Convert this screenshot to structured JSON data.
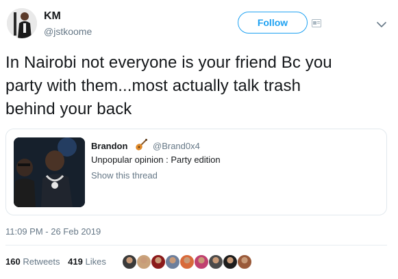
{
  "author": {
    "name": "KM",
    "handle": "@jstkoome",
    "follow_label": "Follow"
  },
  "tweet": {
    "text": "In Nairobi not everyone is your friend Bc you\nparty with them...most actually talk trash\nbehind your back",
    "timestamp": "11:09 PM - 26 Feb 2019"
  },
  "quoted": {
    "name": "Brandon",
    "emoji": "guitar",
    "handle": "@Brand0x4",
    "text": "Unpopular opinion : Party edition",
    "link_label": "Show this thread"
  },
  "stats": {
    "retweets_count": "160",
    "retweets_label": "Retweets",
    "likes_count": "419",
    "likes_label": "Likes"
  },
  "likers": [
    "#3a3a3a",
    "#c9a27a",
    "#8b1a1a",
    "#6d7f9c",
    "#d86a3a",
    "#c04070",
    "#4b4b4b",
    "#1d1d1d",
    "#9a5a3a"
  ],
  "colors": {
    "accent": "#1da1f2",
    "text": "#14171a",
    "secondary": "#657786",
    "border": "#e1e8ed"
  }
}
